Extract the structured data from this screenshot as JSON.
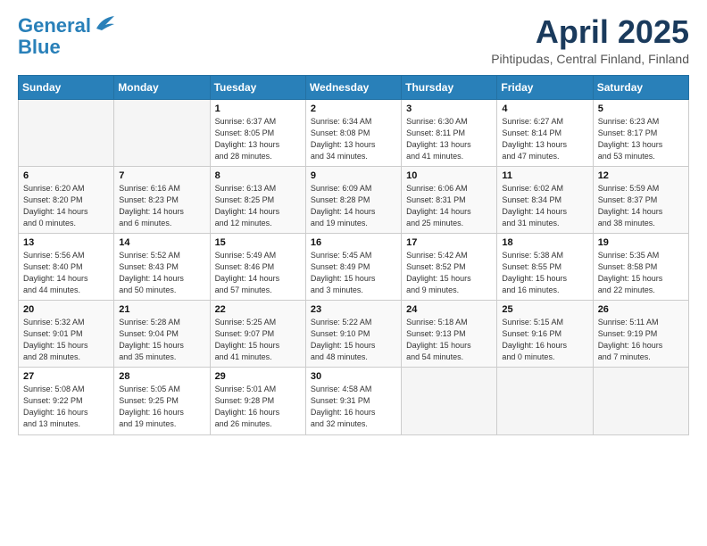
{
  "header": {
    "logo_line1": "General",
    "logo_line2": "Blue",
    "month_title": "April 2025",
    "location": "Pihtipudas, Central Finland, Finland"
  },
  "weekdays": [
    "Sunday",
    "Monday",
    "Tuesday",
    "Wednesday",
    "Thursday",
    "Friday",
    "Saturday"
  ],
  "weeks": [
    [
      {
        "day": "",
        "info": ""
      },
      {
        "day": "",
        "info": ""
      },
      {
        "day": "1",
        "info": "Sunrise: 6:37 AM\nSunset: 8:05 PM\nDaylight: 13 hours\nand 28 minutes."
      },
      {
        "day": "2",
        "info": "Sunrise: 6:34 AM\nSunset: 8:08 PM\nDaylight: 13 hours\nand 34 minutes."
      },
      {
        "day": "3",
        "info": "Sunrise: 6:30 AM\nSunset: 8:11 PM\nDaylight: 13 hours\nand 41 minutes."
      },
      {
        "day": "4",
        "info": "Sunrise: 6:27 AM\nSunset: 8:14 PM\nDaylight: 13 hours\nand 47 minutes."
      },
      {
        "day": "5",
        "info": "Sunrise: 6:23 AM\nSunset: 8:17 PM\nDaylight: 13 hours\nand 53 minutes."
      }
    ],
    [
      {
        "day": "6",
        "info": "Sunrise: 6:20 AM\nSunset: 8:20 PM\nDaylight: 14 hours\nand 0 minutes."
      },
      {
        "day": "7",
        "info": "Sunrise: 6:16 AM\nSunset: 8:23 PM\nDaylight: 14 hours\nand 6 minutes."
      },
      {
        "day": "8",
        "info": "Sunrise: 6:13 AM\nSunset: 8:25 PM\nDaylight: 14 hours\nand 12 minutes."
      },
      {
        "day": "9",
        "info": "Sunrise: 6:09 AM\nSunset: 8:28 PM\nDaylight: 14 hours\nand 19 minutes."
      },
      {
        "day": "10",
        "info": "Sunrise: 6:06 AM\nSunset: 8:31 PM\nDaylight: 14 hours\nand 25 minutes."
      },
      {
        "day": "11",
        "info": "Sunrise: 6:02 AM\nSunset: 8:34 PM\nDaylight: 14 hours\nand 31 minutes."
      },
      {
        "day": "12",
        "info": "Sunrise: 5:59 AM\nSunset: 8:37 PM\nDaylight: 14 hours\nand 38 minutes."
      }
    ],
    [
      {
        "day": "13",
        "info": "Sunrise: 5:56 AM\nSunset: 8:40 PM\nDaylight: 14 hours\nand 44 minutes."
      },
      {
        "day": "14",
        "info": "Sunrise: 5:52 AM\nSunset: 8:43 PM\nDaylight: 14 hours\nand 50 minutes."
      },
      {
        "day": "15",
        "info": "Sunrise: 5:49 AM\nSunset: 8:46 PM\nDaylight: 14 hours\nand 57 minutes."
      },
      {
        "day": "16",
        "info": "Sunrise: 5:45 AM\nSunset: 8:49 PM\nDaylight: 15 hours\nand 3 minutes."
      },
      {
        "day": "17",
        "info": "Sunrise: 5:42 AM\nSunset: 8:52 PM\nDaylight: 15 hours\nand 9 minutes."
      },
      {
        "day": "18",
        "info": "Sunrise: 5:38 AM\nSunset: 8:55 PM\nDaylight: 15 hours\nand 16 minutes."
      },
      {
        "day": "19",
        "info": "Sunrise: 5:35 AM\nSunset: 8:58 PM\nDaylight: 15 hours\nand 22 minutes."
      }
    ],
    [
      {
        "day": "20",
        "info": "Sunrise: 5:32 AM\nSunset: 9:01 PM\nDaylight: 15 hours\nand 28 minutes."
      },
      {
        "day": "21",
        "info": "Sunrise: 5:28 AM\nSunset: 9:04 PM\nDaylight: 15 hours\nand 35 minutes."
      },
      {
        "day": "22",
        "info": "Sunrise: 5:25 AM\nSunset: 9:07 PM\nDaylight: 15 hours\nand 41 minutes."
      },
      {
        "day": "23",
        "info": "Sunrise: 5:22 AM\nSunset: 9:10 PM\nDaylight: 15 hours\nand 48 minutes."
      },
      {
        "day": "24",
        "info": "Sunrise: 5:18 AM\nSunset: 9:13 PM\nDaylight: 15 hours\nand 54 minutes."
      },
      {
        "day": "25",
        "info": "Sunrise: 5:15 AM\nSunset: 9:16 PM\nDaylight: 16 hours\nand 0 minutes."
      },
      {
        "day": "26",
        "info": "Sunrise: 5:11 AM\nSunset: 9:19 PM\nDaylight: 16 hours\nand 7 minutes."
      }
    ],
    [
      {
        "day": "27",
        "info": "Sunrise: 5:08 AM\nSunset: 9:22 PM\nDaylight: 16 hours\nand 13 minutes."
      },
      {
        "day": "28",
        "info": "Sunrise: 5:05 AM\nSunset: 9:25 PM\nDaylight: 16 hours\nand 19 minutes."
      },
      {
        "day": "29",
        "info": "Sunrise: 5:01 AM\nSunset: 9:28 PM\nDaylight: 16 hours\nand 26 minutes."
      },
      {
        "day": "30",
        "info": "Sunrise: 4:58 AM\nSunset: 9:31 PM\nDaylight: 16 hours\nand 32 minutes."
      },
      {
        "day": "",
        "info": ""
      },
      {
        "day": "",
        "info": ""
      },
      {
        "day": "",
        "info": ""
      }
    ]
  ]
}
